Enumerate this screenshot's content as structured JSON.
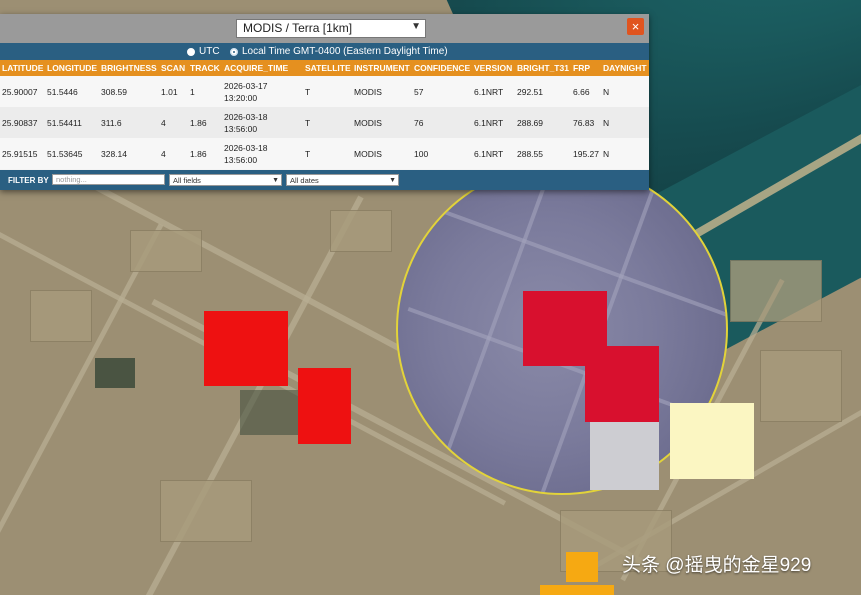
{
  "popup": {
    "satellite_select": "MODIS / Terra [1km]",
    "close_label": "×",
    "time_options": [
      {
        "label": "UTC",
        "selected": false
      },
      {
        "label": "Local Time GMT-0400 (Eastern Daylight Time)",
        "selected": true
      }
    ],
    "columns": [
      "LATITUDE",
      "LONGITUDE",
      "BRIGHTNESS",
      "SCAN",
      "TRACK",
      "ACQUIRE_TIME",
      "SATELLITE",
      "INSTRUMENT",
      "CONFIDENCE",
      "VERSION",
      "BRIGHT_T31",
      "FRP",
      "DAYNIGHT"
    ],
    "rows": [
      {
        "latitude": "25.90007",
        "longitude": "51.5446",
        "brightness": "308.59",
        "scan": "1.01",
        "track": "1",
        "date": "2026-03-17",
        "time": "13:20:00",
        "satellite": "T",
        "instrument": "MODIS",
        "confidence": "57",
        "version": "6.1NRT",
        "bright_t31": "292.51",
        "frp": "6.66",
        "daynight": "N"
      },
      {
        "latitude": "25.90837",
        "longitude": "51.54411",
        "brightness": "311.6",
        "scan": "4",
        "track": "1.86",
        "date": "2026-03-18",
        "time": "13:56:00",
        "satellite": "T",
        "instrument": "MODIS",
        "confidence": "76",
        "version": "6.1NRT",
        "bright_t31": "288.69",
        "frp": "76.83",
        "daynight": "N"
      },
      {
        "latitude": "25.91515",
        "longitude": "51.53645",
        "brightness": "328.14",
        "scan": "4",
        "track": "1.86",
        "date": "2026-03-18",
        "time": "13:56:00",
        "satellite": "T",
        "instrument": "MODIS",
        "confidence": "100",
        "version": "6.1NRT",
        "bright_t31": "288.55",
        "frp": "195.27",
        "daynight": "N"
      }
    ],
    "filter": {
      "label": "FILTER BY",
      "input_placeholder": "nothing...",
      "field_select": "All fields",
      "date_select": "All dates"
    }
  },
  "map": {
    "fire_colors": {
      "high": "#ee1111",
      "high_in_lens": "#d8102e",
      "low": "#fbf6c2",
      "grey": "#cdcdd2",
      "orange": "#f6a912"
    },
    "lens_border": "#e2d33a"
  },
  "watermark": "头条 @摇曳的金星929"
}
